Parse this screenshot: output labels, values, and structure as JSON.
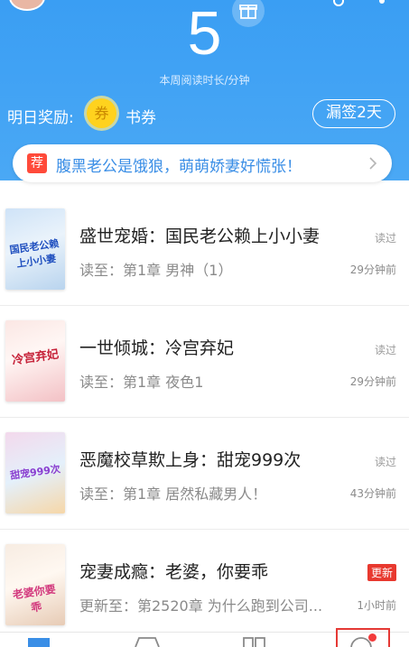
{
  "header": {
    "weekly_minutes": "5",
    "subtitle": "本周阅读时长/分钟",
    "reward_label": "明日奖励:",
    "coupon_icon_char": "券",
    "coupon_label": "书券",
    "streak_button": "漏签2天",
    "colors": {
      "background": "#3a9ef3",
      "coupon": "#ffd21e"
    }
  },
  "recommend": {
    "badge": "荐",
    "text": "腹黑老公是饿狼，萌萌娇妻好慌张！"
  },
  "books": [
    {
      "title": "盛世宠婚：国民老公赖上小小妻",
      "progress": "读至：第1章 男神（1）",
      "status": "读过",
      "time": "29分钟前",
      "cover_text": "国民老公赖上小小妻",
      "updated": false
    },
    {
      "title": "一世倾城：冷宫弃妃",
      "progress": "读至：第1章 夜色1",
      "status": "读过",
      "time": "29分钟前",
      "cover_text": "冷宫弃妃",
      "updated": false
    },
    {
      "title": "恶魔校草欺上身：甜宠999次",
      "progress": "读至：第1章 居然私藏男人！",
      "status": "读过",
      "time": "43分钟前",
      "cover_text": "甜宠999次",
      "updated": false
    },
    {
      "title": "宠妻成瘾：老婆，你要乖",
      "progress": "更新至：第2520章 为什么跑到公司...",
      "status": "更新",
      "time": "1小时前",
      "cover_text": "老婆你要乖",
      "updated": true
    }
  ],
  "bottom_nav": {
    "icons": [
      "bookshelf-icon",
      "bookstore-icon",
      "category-icon",
      "profile-icon"
    ]
  }
}
